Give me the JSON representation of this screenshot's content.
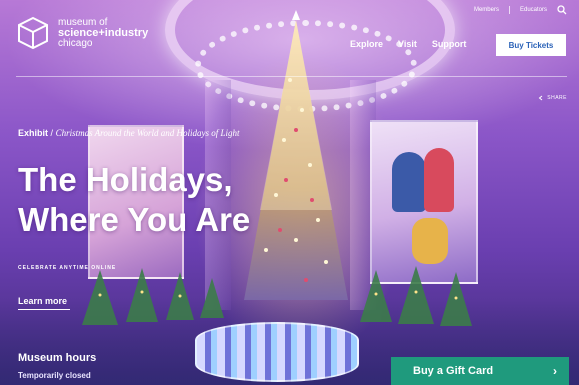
{
  "logo": {
    "line1": "museum of",
    "line2": "science+industry",
    "line3": "chicago"
  },
  "utility_nav": {
    "members": "Members",
    "educators": "Educators"
  },
  "main_nav": [
    {
      "label": "Explore"
    },
    {
      "label": "Visit"
    },
    {
      "label": "Support"
    }
  ],
  "buy_tickets": "Buy Tickets",
  "share_label": "SHARE",
  "hero": {
    "category": "Exhibit",
    "separator": "/",
    "exhibit_title": "Christmas Around the World and Holidays of Light",
    "headline_line1": "The Holidays,",
    "headline_line2": "Where You Are",
    "kicker": "CELEBRATE ANYTIME ONLINE",
    "learn_more": "Learn more"
  },
  "hours": {
    "title": "Museum hours",
    "status": "Temporarily closed"
  },
  "gift_card": {
    "label": "Buy a Gift Card"
  },
  "colors": {
    "accent_blue": "#2c63b8",
    "gift_green": "#1f9a7d",
    "hero_purple": "#8b56c8"
  },
  "icons": [
    "logo-cube-icon",
    "search-icon",
    "share-icon",
    "arrow-right-icon"
  ]
}
